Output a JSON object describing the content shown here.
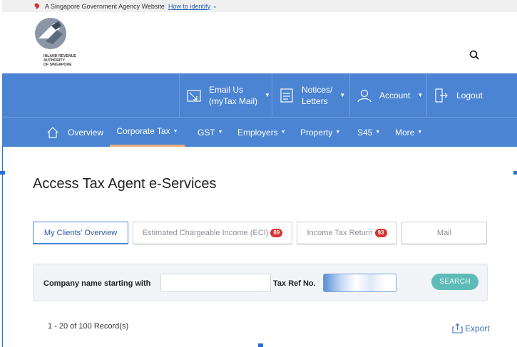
{
  "gov_bar": {
    "text": "A Singapore Government Agency Website",
    "link": "How to identify"
  },
  "header": {
    "logo_text_line1": "INLAND REVENUE",
    "logo_text_line2": "AUTHORITY",
    "logo_text_line3": "OF SINGAPORE",
    "search_icon": "search-icon"
  },
  "utility": {
    "email_line1": "Email Us",
    "email_line2": "(myTax Mail)",
    "notices_line1": "Notices/",
    "notices_line2": "Letters",
    "account": "Account",
    "logout": "Logout"
  },
  "nav": {
    "items": [
      {
        "label": "Overview"
      },
      {
        "label": "Corporate Tax"
      },
      {
        "label": "GST"
      },
      {
        "label": "Employers"
      },
      {
        "label": "Property"
      },
      {
        "label": "S45"
      },
      {
        "label": "More"
      }
    ]
  },
  "page": {
    "title": "Access Tax Agent e-Services"
  },
  "tabs": [
    {
      "label": "My Clients' Overview",
      "badge": ""
    },
    {
      "label": "Estimated Chargeable Income (ECI)",
      "badge": "89"
    },
    {
      "label": "Income Tax Return",
      "badge": "93"
    },
    {
      "label": "Mail",
      "badge": ""
    }
  ],
  "filter": {
    "company_label": "Company name starting with",
    "company_value": "",
    "taxref_label": "Tax Ref No.",
    "taxref_value": "",
    "search_label": "SEARCH"
  },
  "results": {
    "records": "1 - 20 of 100 Record(s)",
    "export_label": "Export"
  },
  "colors": {
    "primary": "#4a84d2",
    "accent_teal": "#5dbcb8",
    "badge_red": "#d6322f",
    "active_underline": "#e8b07a"
  }
}
